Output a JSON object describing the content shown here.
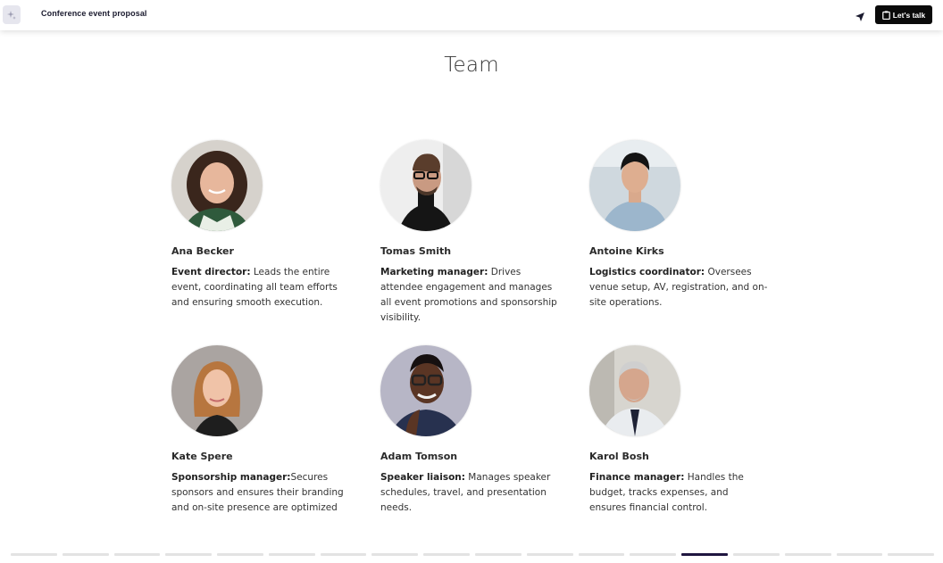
{
  "header": {
    "doc_title": "Conference event proposal",
    "cta_label": "Let's talk"
  },
  "section": {
    "title": "Team"
  },
  "members": [
    {
      "name": "Ana Becker",
      "role": "Event director:",
      "desc": " Leads the entire event, coordinating all team efforts and ensuring smooth execution."
    },
    {
      "name": "Tomas Smith",
      "role": "Marketing manager:",
      "desc": " Drives attendee engagement and manages all event promotions and sponsorship visibility."
    },
    {
      "name": "Antoine Kirks",
      "role": "Logistics coordinator:",
      "desc": " Oversees venue setup, AV, registration, and on-site operations."
    },
    {
      "name": "Kate Spere",
      "role": "Sponsorship manager:",
      "desc": "Secures sponsors and ensures their branding and on-site presence are optimized"
    },
    {
      "name": "Adam Tomson",
      "role": "Speaker liaison:",
      "desc": " Manages speaker schedules, travel, and presentation needs."
    },
    {
      "name": "Karol Bosh",
      "role": "Finance manager:",
      "desc": " Handles the budget, tracks expenses, and ensures financial control."
    }
  ],
  "progress": {
    "total_slides": 18,
    "current_slide": 14
  },
  "colors": {
    "accent": "#1f1640",
    "cta_bg": "#0a0a0a"
  }
}
